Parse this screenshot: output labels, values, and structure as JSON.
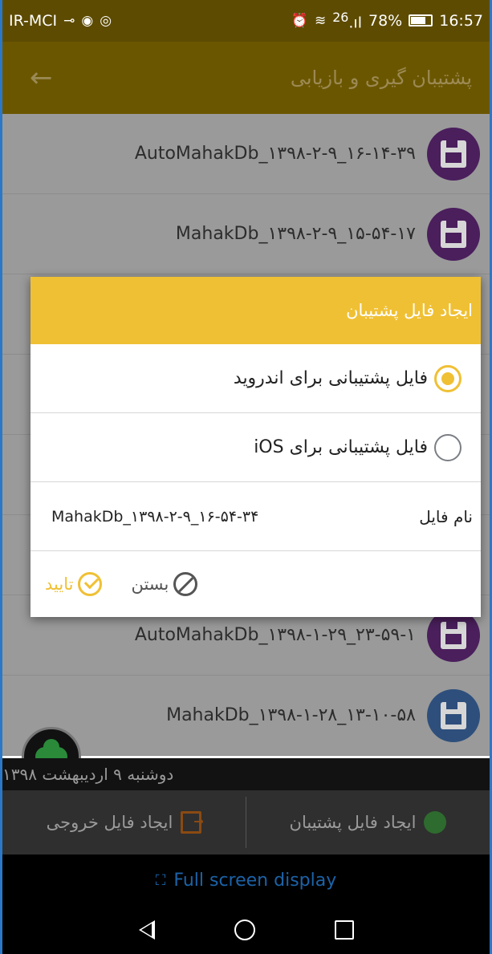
{
  "status_bar": {
    "carrier": "IR-MCI",
    "signal_info": "26",
    "battery": "78%",
    "time": "16:57"
  },
  "app_bar": {
    "title": "پشتیبان گیری و بازیابی",
    "back_icon": "arrow-left-icon"
  },
  "backup_list": [
    {
      "name": "AutoMahakDb_۱۳۹۸-۲-۹_۱۶-۱۴-۳۹",
      "icon": "floppy-icon",
      "color": "#4a1f5c"
    },
    {
      "name": "MahakDb_۱۳۹۸-۲-۹_۱۵-۵۴-۱۷",
      "icon": "floppy-icon",
      "color": "#4a1f5c"
    },
    {
      "name": "",
      "icon": "floppy-icon",
      "color": "#4a1f5c"
    },
    {
      "name": "",
      "icon": "floppy-icon",
      "color": "#4a1f5c"
    },
    {
      "name": "",
      "icon": "floppy-icon",
      "color": "#4a1f5c"
    },
    {
      "name": "",
      "icon": "floppy-icon",
      "color": "#4a1f5c"
    },
    {
      "name": "AutoMahakDb_۱۳۹۸-۱-۲۹_۲۳-۵۹-۱",
      "icon": "floppy-icon",
      "color": "#4a1f5c"
    },
    {
      "name": "MahakDb_۱۳۹۸-۱-۲۸_۱۳-۱۰-۵۸",
      "icon": "floppy-ios-icon",
      "color": "#2e4f7c"
    }
  ],
  "date_text": "دوشنبه ۹ اردیبهشت ۱۳۹۸",
  "actions": {
    "create_backup": "ایجاد فایل پشتیبان",
    "create_export": "ایجاد فایل خروجی"
  },
  "full_screen": "Full screen display",
  "dialog": {
    "title": "ایجاد فایل پشتیبان",
    "option_android": "فایل پشتیبانی برای اندروید",
    "option_ios": "فایل پشتیبانی برای iOS",
    "selected_option": "android",
    "file_name_label": "نام فایل",
    "file_name_value": "MahakDb_۱۳۹۸-۲-۹_۱۶-۵۴-۳۴",
    "confirm_label": "تایید",
    "close_label": "بستن"
  },
  "colors": {
    "accent": "#f0c034",
    "purple": "#4a1f5c",
    "blue": "#2e4f7c"
  }
}
